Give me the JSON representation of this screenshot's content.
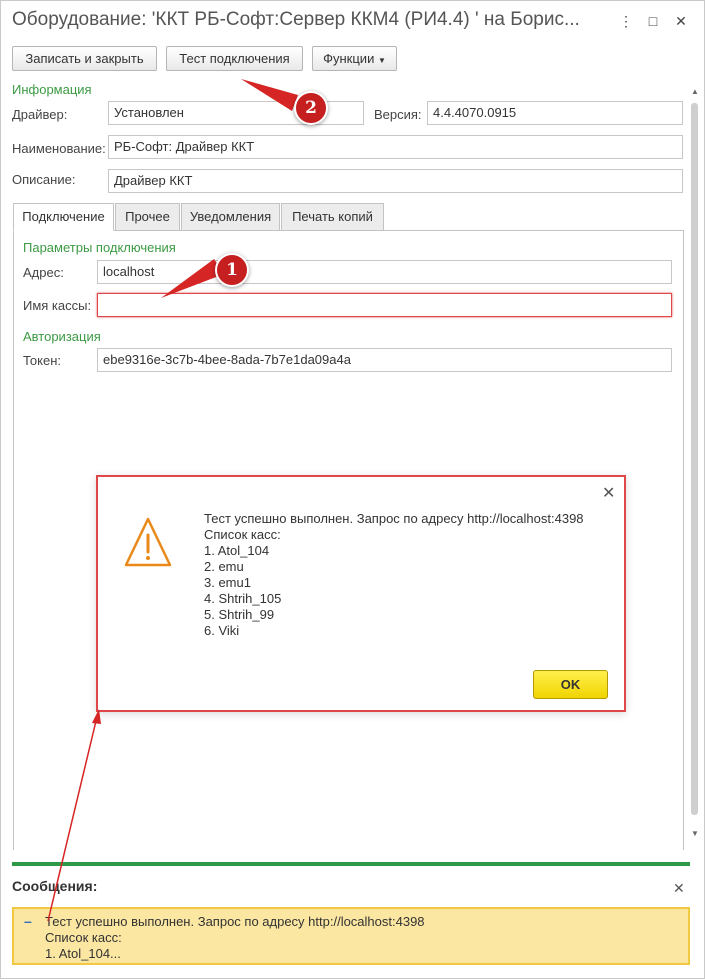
{
  "window": {
    "title": "Оборудование: 'ККТ РБ-Софт:Сервер ККМ4 (РИ4.4) ' на Борис..."
  },
  "toolbar": {
    "save_close_label": "Записать и закрыть",
    "test_connection_label": "Тест подключения",
    "functions_label": "Функции"
  },
  "info": {
    "section_title": "Информация",
    "driver_label": "Драйвер:",
    "driver_value": "Установлен",
    "version_label": "Версия:",
    "version_value": "4.4.4070.0915",
    "name_label": "Наименование:",
    "name_value": "РБ-Софт: Драйвер ККТ",
    "description_label": "Описание:",
    "description_value": "Драйвер ККТ"
  },
  "tabs": [
    {
      "label": "Подключение",
      "active": true
    },
    {
      "label": "Прочее",
      "active": false
    },
    {
      "label": "Уведомления",
      "active": false
    },
    {
      "label": "Печать копий",
      "active": false
    }
  ],
  "connection": {
    "section_title": "Параметры подключения",
    "address_label": "Адрес:",
    "address_value": "localhost",
    "register_name_label": "Имя кассы:",
    "register_name_value": "",
    "auth_title": "Авторизация",
    "token_label": "Токен:",
    "token_value": "ebe9316e-3c7b-4bee-8ada-7b7e1da09a4a"
  },
  "dialog": {
    "lines": [
      "Тест успешно выполнен. Запрос по адресу http://localhost:4398",
      "Список касс:",
      "1. Atol_104",
      "2. emu",
      "3. emu1",
      "4. Shtrih_105",
      "5. Shtrih_99",
      "6. Viki"
    ],
    "ok_label": "OK",
    "icon": "warning-triangle-icon"
  },
  "messages": {
    "title": "Сообщения:",
    "lines": [
      "Тест успешно выполнен. Запрос по адресу http://localhost:4398",
      "Список касс:",
      "1. Atol_104..."
    ]
  },
  "annotations": {
    "badge_1": "1",
    "badge_2": "2"
  },
  "colors": {
    "accent_green": "#3c9a43",
    "annotation_red": "#c61f1f",
    "ok_yellow": "#f0d400",
    "message_bg": "#fbe7a2"
  }
}
